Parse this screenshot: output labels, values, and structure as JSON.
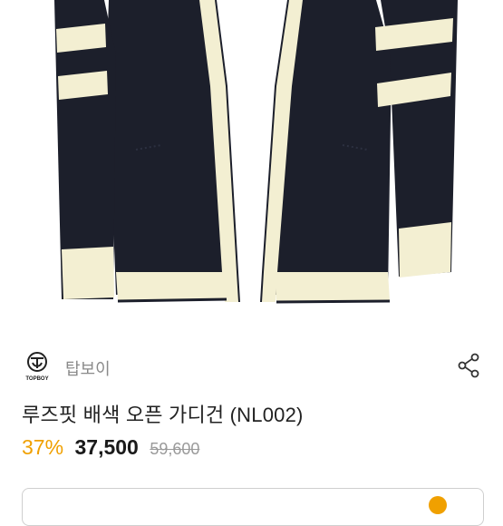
{
  "brand": {
    "logo_text": "TOPBOY",
    "name": "탑보이"
  },
  "product": {
    "title": "루즈핏 배색 오픈 가디건 (NL002)",
    "discount": "37%",
    "price": "37,500",
    "original_price": "59,600"
  },
  "icons": {
    "share": "share-icon"
  },
  "colors": {
    "navy": "#1c1f2b",
    "cream": "#f3efd2",
    "accent": "#f0a000"
  }
}
